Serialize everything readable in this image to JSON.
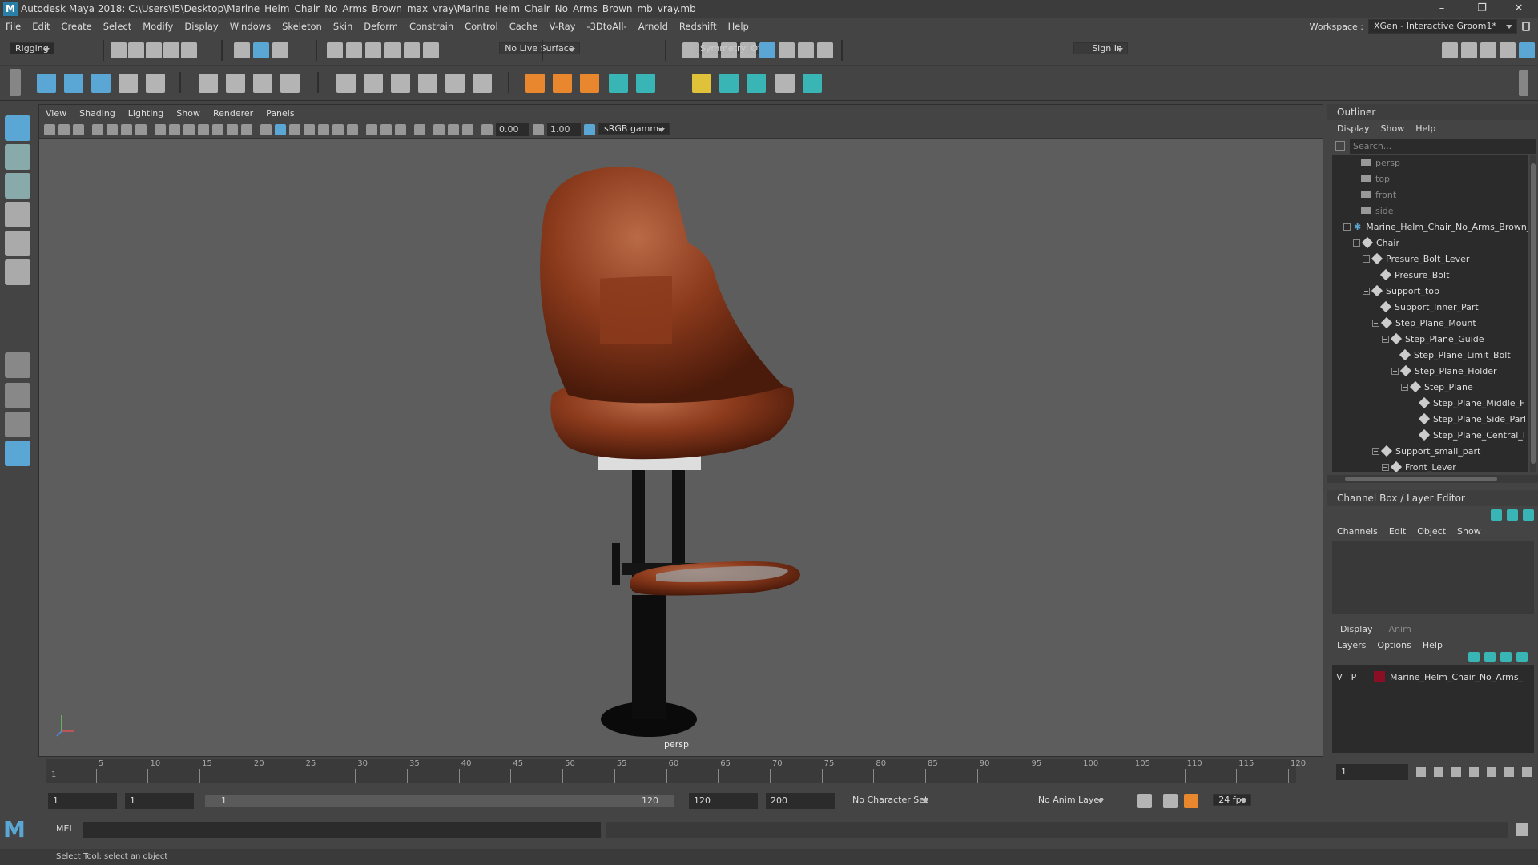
{
  "window": {
    "title": "Autodesk Maya 2018: C:\\Users\\I5\\Desktop\\Marine_Helm_Chair_No_Arms_Brown_max_vray\\Marine_Helm_Chair_No_Arms_Brown_mb_vray.mb",
    "minimize": "–",
    "maximize": "❐",
    "close": "✕"
  },
  "menubar": {
    "items": [
      "File",
      "Edit",
      "Create",
      "Select",
      "Modify",
      "Display",
      "Windows",
      "Skeleton",
      "Skin",
      "Deform",
      "Constrain",
      "Control",
      "Cache",
      "V-Ray",
      "-3DtoAll-",
      "Arnold",
      "Redshift",
      "Help"
    ],
    "workspace_label": "Workspace :",
    "workspace_value": "XGen - Interactive Groom1*"
  },
  "statusline": {
    "mode": "Rigging",
    "live_surface": "No Live Surface",
    "symmetry": "Symmetry: Off",
    "sign_in": "Sign In"
  },
  "viewport": {
    "menu": [
      "View",
      "Shading",
      "Lighting",
      "Show",
      "Renderer",
      "Panels"
    ],
    "exposure": "0.00",
    "gamma": "1.00",
    "color_space": "sRGB gamma",
    "camera_label": "persp"
  },
  "outliner": {
    "title": "Outliner",
    "menu": [
      "Display",
      "Show",
      "Help"
    ],
    "search_placeholder": "Search...",
    "items": [
      {
        "label": "persp",
        "type": "camera",
        "depth": 0
      },
      {
        "label": "top",
        "type": "camera",
        "depth": 0
      },
      {
        "label": "front",
        "type": "camera",
        "depth": 0
      },
      {
        "label": "side",
        "type": "camera",
        "depth": 0
      },
      {
        "label": "Marine_Helm_Chair_No_Arms_Brown_",
        "type": "root",
        "depth": 0
      },
      {
        "label": "Chair",
        "type": "node",
        "depth": 1
      },
      {
        "label": "Presure_Bolt_Lever",
        "type": "node",
        "depth": 2
      },
      {
        "label": "Presure_Bolt",
        "type": "node",
        "depth": 3
      },
      {
        "label": "Support_top",
        "type": "node",
        "depth": 2
      },
      {
        "label": "Support_Inner_Part",
        "type": "node",
        "depth": 3
      },
      {
        "label": "Step_Plane_Mount",
        "type": "node",
        "depth": 3
      },
      {
        "label": "Step_Plane_Guide",
        "type": "node",
        "depth": 4
      },
      {
        "label": "Step_Plane_Limit_Bolt",
        "type": "node",
        "depth": 5
      },
      {
        "label": "Step_Plane_Holder",
        "type": "node",
        "depth": 5
      },
      {
        "label": "Step_Plane",
        "type": "node",
        "depth": 6
      },
      {
        "label": "Step_Plane_Middle_F",
        "type": "node",
        "depth": 7
      },
      {
        "label": "Step_Plane_Side_Parl",
        "type": "node",
        "depth": 7
      },
      {
        "label": "Step_Plane_Central_I",
        "type": "node",
        "depth": 7
      },
      {
        "label": "Support_small_part",
        "type": "node",
        "depth": 3
      },
      {
        "label": "Front_Lever",
        "type": "node",
        "depth": 4
      }
    ]
  },
  "channelbox": {
    "title": "Channel Box / Layer Editor",
    "menu": [
      "Channels",
      "Edit",
      "Object",
      "Show"
    ],
    "tabs": [
      "Display",
      "Anim"
    ],
    "layer_menu": [
      "Layers",
      "Options",
      "Help"
    ],
    "layer": {
      "v": "V",
      "p": "P",
      "name": "Marine_Helm_Chair_No_Arms_",
      "color": "#8a0f24"
    }
  },
  "timeline": {
    "ticks": [
      "5",
      "10",
      "15",
      "20",
      "25",
      "30",
      "35",
      "40",
      "45",
      "50",
      "55",
      "60",
      "65",
      "70",
      "75",
      "80",
      "85",
      "90",
      "95",
      "100",
      "105",
      "110",
      "115",
      "120"
    ],
    "start_tick": "1",
    "current_frame": "1"
  },
  "range": {
    "start": "1",
    "anim_start": "1",
    "slider_start": "1",
    "slider_end": "120",
    "end": "120",
    "anim_end": "200",
    "character_set": "No Character Set",
    "anim_layer": "No Anim Layer",
    "fps": "24 fps"
  },
  "mel": {
    "label": "MEL"
  },
  "helpline": {
    "text": "Select Tool: select an object"
  },
  "colors": {
    "accent": "#5aa7d6",
    "leather": "#8b3a1c",
    "layer": "#8a0f24"
  }
}
